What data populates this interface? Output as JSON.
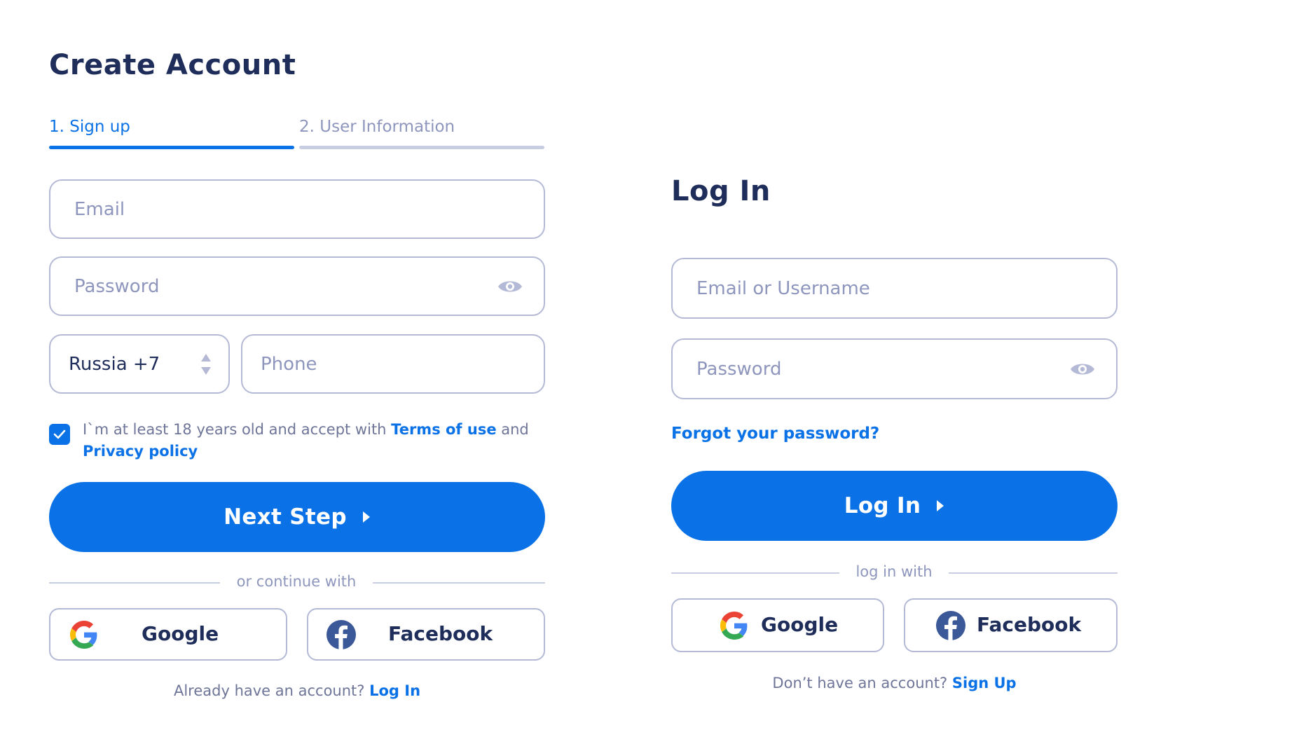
{
  "signup": {
    "title": "Create Account",
    "tabs": [
      {
        "label": "1. Sign up",
        "active": true
      },
      {
        "label": "2. User Information",
        "active": false
      }
    ],
    "email_placeholder": "Email",
    "password_placeholder": "Password",
    "country_value": "Russia +7",
    "phone_placeholder": "Phone",
    "consent": {
      "checked": true,
      "text_before": "I`m at least 18 years old and accept with ",
      "terms_link": "Terms of use",
      "text_and": " and",
      "privacy_link": "Privacy policy"
    },
    "next_button": "Next Step",
    "divider": "or continue with",
    "google_label": "Google",
    "facebook_label": "Facebook",
    "footer_text": "Already have an account? ",
    "footer_link": "Log In"
  },
  "login": {
    "title": "Log In",
    "username_placeholder": "Email or Username",
    "password_placeholder": "Password",
    "forgot_link": "Forgot your password?",
    "login_button": "Log In",
    "divider": "log in with",
    "google_label": "Google",
    "facebook_label": "Facebook",
    "footer_text": "Don’t have an account? ",
    "footer_link": "Sign Up"
  },
  "colors": {
    "primary": "#0a72e6",
    "heading": "#1f2d5a",
    "muted": "#8e96bd",
    "border": "#b4b9d6"
  },
  "icons": [
    "eye-icon",
    "sort-arrows-icon",
    "check-icon",
    "play-arrow-icon",
    "google-icon",
    "facebook-icon"
  ]
}
